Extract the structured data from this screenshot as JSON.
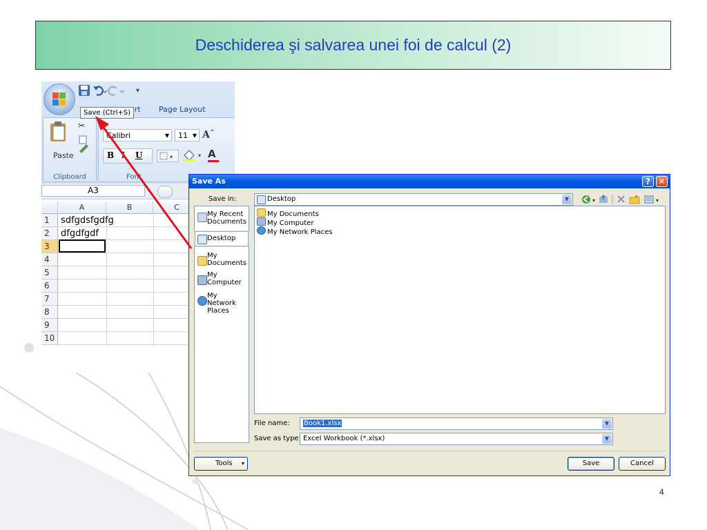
{
  "slide": {
    "title": "Deschiderea şi salvarea unei foi de calcul (2)",
    "page_number": "4"
  },
  "excel": {
    "tooltip": "Save (Ctrl+S)",
    "tabs": [
      "ert",
      "Page Layout"
    ],
    "font_name": "Calibri",
    "font_size": "11",
    "paste_label": "Paste",
    "groups": {
      "clipboard": "Clipboard",
      "font": "Font"
    },
    "name_box": "A3",
    "columns": [
      "A",
      "B",
      "C"
    ],
    "rows": [
      "1",
      "2",
      "3",
      "4",
      "5",
      "6",
      "7",
      "8",
      "9",
      "10"
    ],
    "cells": {
      "A1": "sdfgdsfgdfg",
      "A2": "dfgdfgdf"
    },
    "format_buttons": {
      "bold": "B",
      "italic": "I",
      "underline": "U",
      "font_color": "A",
      "grow_font": "A"
    }
  },
  "dialog": {
    "title": "Save As",
    "help_button": "?",
    "close_button": "✕",
    "save_in_label": "Save in:",
    "save_in_value": "Desktop",
    "places": [
      "My Recent Documents",
      "Desktop",
      "My Documents",
      "My Computer",
      "My Network Places"
    ],
    "files": [
      "My Documents",
      "My Computer",
      "My Network Places"
    ],
    "file_name_label": "File name:",
    "file_name_value": "Book1.xlsx",
    "save_type_label": "Save as type:",
    "save_type_value": "Excel Workbook (*.xlsx)",
    "tools_button": "Tools",
    "save_button": "Save",
    "cancel_button": "Cancel"
  },
  "colors": {
    "title_text": "#1f3fbf",
    "arrow": "#e0121b",
    "dialog_titlebar": "#0058e6",
    "close_button": "#e0452f"
  }
}
